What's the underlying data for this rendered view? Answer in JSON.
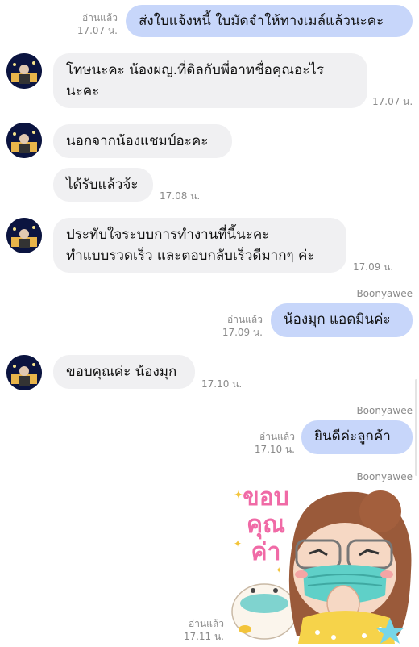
{
  "messages": [
    {
      "type": "out",
      "text": "ส่งใบแจ้งหนี้ ใบมัดจำให้ทางเมล์แล้วนะคะ",
      "read": "อ่านแล้ว",
      "time": "17.07 น."
    },
    {
      "type": "in",
      "lines": [
        "โทษนะคะ น้องผญ.ที่ดิลกับพี่อาทชื่อคุณอะไร",
        "นะคะ"
      ],
      "time": "17.07 น."
    },
    {
      "type": "in",
      "text": "นอกจากน้องแชมป์อะคะ"
    },
    {
      "type": "in",
      "text": "ได้รับแล้วจ้ะ",
      "time": "17.08 น."
    },
    {
      "type": "in",
      "lines": [
        "ประทับใจระบบการทำงานที่นี้นะคะ",
        "ทำแบบรวดเร็ว และตอบกลับเร็วดีมากๆ ค่ะ"
      ],
      "time": "17.09 น."
    },
    {
      "type": "out",
      "sender": "Boonyawee",
      "text": "น้องมุก แอดมินค่ะ",
      "read": "อ่านแล้ว",
      "time": "17.09 น."
    },
    {
      "type": "in",
      "text": "ขอบคุณค่ะ น้องมุก",
      "time": "17.10 น."
    },
    {
      "type": "out",
      "sender": "Boonyawee",
      "text": "ยินดีค่ะลูกค้า",
      "read": "อ่านแล้ว",
      "time": "17.10 น."
    },
    {
      "type": "sticker",
      "sender": "Boonyawee",
      "sticker_text": [
        "ขอบ",
        "คุณ",
        "ค่า"
      ],
      "read": "อ่านแล้ว",
      "time": "17.11 น."
    }
  ],
  "colors": {
    "out_bubble": "#c7d6fa",
    "in_bubble": "#f0f0f2",
    "meta": "#8a8a8a",
    "sticker_text": "#f06aa6"
  },
  "icons": {
    "avatar": "avatar-icon",
    "sticker": "thank-you-sticker"
  }
}
